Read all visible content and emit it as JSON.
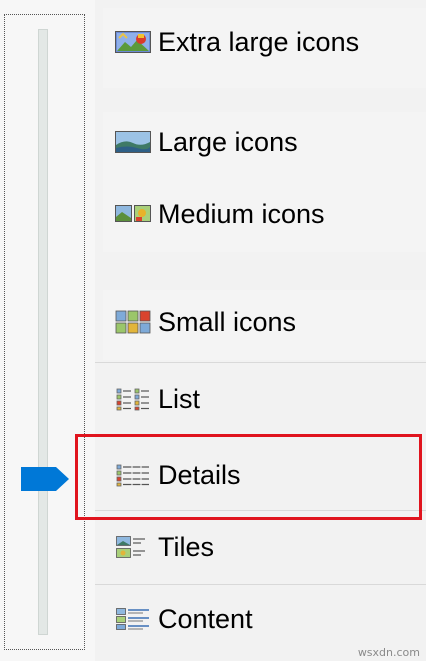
{
  "view_menu": {
    "items": [
      {
        "label": "Extra large icons",
        "icon": "extra-large-icons-icon"
      },
      {
        "label": "Large icons",
        "icon": "large-icons-icon"
      },
      {
        "label": "Medium icons",
        "icon": "medium-icons-icon"
      },
      {
        "label": "Small icons",
        "icon": "small-icons-icon"
      },
      {
        "label": "List",
        "icon": "list-icon"
      },
      {
        "label": "Details",
        "icon": "details-icon"
      },
      {
        "label": "Tiles",
        "icon": "tiles-icon"
      },
      {
        "label": "Content",
        "icon": "content-icon"
      }
    ],
    "selected": "Details"
  },
  "slider": {
    "accent_color": "#0078d7"
  },
  "annotation": {
    "color": "#e0141e"
  },
  "watermark": "wsxdn.com"
}
